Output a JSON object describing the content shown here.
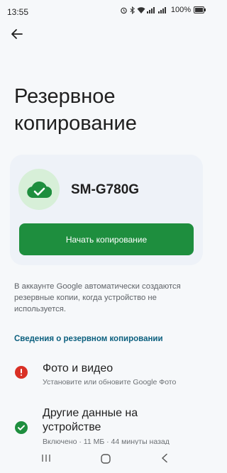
{
  "status": {
    "time": "13:55",
    "battery": "100%"
  },
  "title": "Резервное копирование",
  "device": {
    "name": "SM-G780G",
    "start_button": "Начать копирование"
  },
  "info_text": "В аккаунте Google автоматически создаются резервные копии, когда устройство не используется.",
  "section_header": "Сведения о резервном копировании",
  "items": [
    {
      "title": "Фото и видео",
      "subtitle": "Установите или обновите Google Фото",
      "status": "error"
    },
    {
      "title": "Другие данные на устройстве",
      "subtitle": "Включено · 11 МБ · 44 минуты назад",
      "status": "ok"
    }
  ],
  "colors": {
    "accent": "#1e8e3e",
    "error": "#d93025",
    "link": "#0b5f7e"
  }
}
